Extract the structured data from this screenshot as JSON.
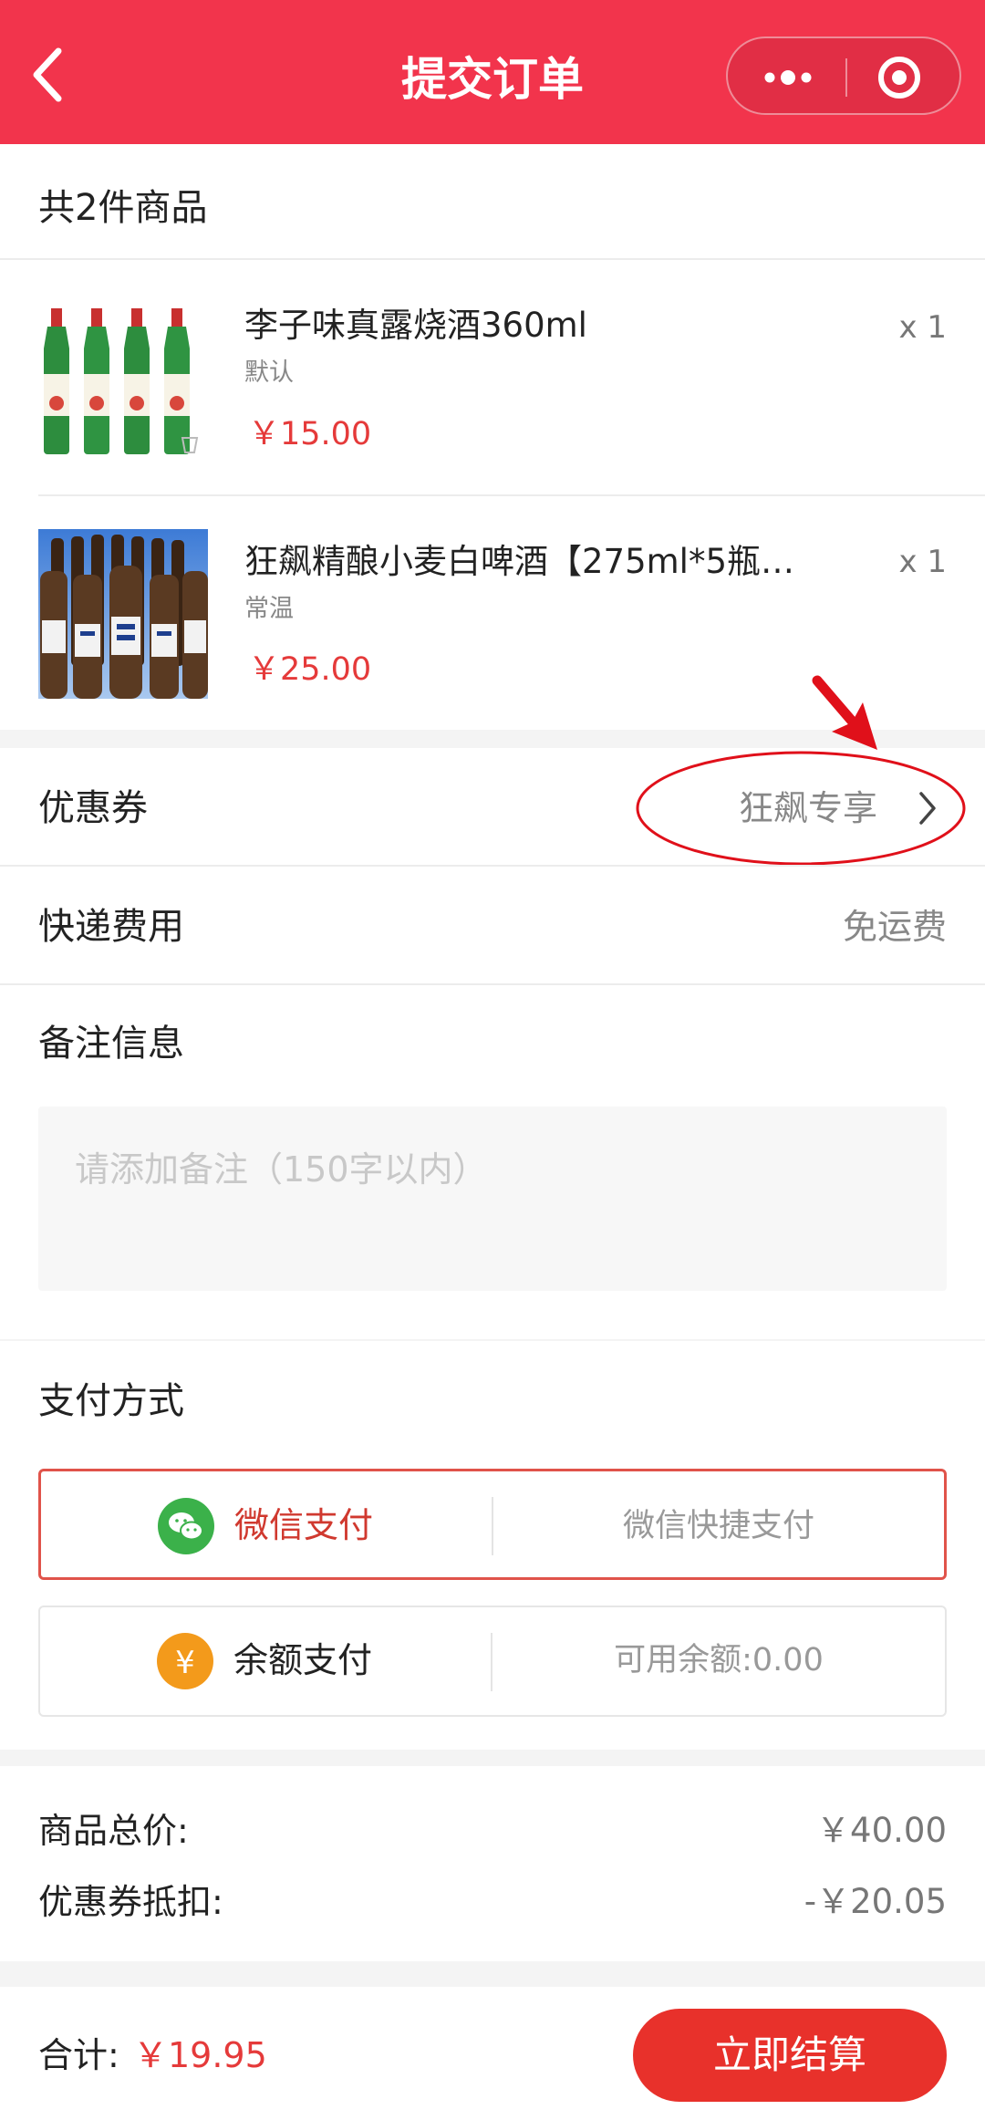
{
  "header": {
    "title": "提交订单"
  },
  "order": {
    "count_label": "共2件商品",
    "items": [
      {
        "name": "李子味真露烧酒360ml",
        "spec": "默认",
        "price": "￥15.00",
        "qty": "x 1"
      },
      {
        "name": "狂飙精酿小麦白啤酒【275ml*5瓶…",
        "spec": "常温",
        "price": "￥25.00",
        "qty": "x 1"
      }
    ]
  },
  "coupon": {
    "label": "优惠券",
    "value": "狂飙专享"
  },
  "shipping": {
    "label": "快递费用",
    "value": "免运费"
  },
  "remark": {
    "label": "备注信息",
    "placeholder": "请添加备注（150字以内）"
  },
  "payment": {
    "label": "支付方式",
    "methods": [
      {
        "name": "微信支付",
        "desc": "微信快捷支付",
        "selected": true,
        "icon": "wechat-icon",
        "color": "#3bb14a"
      },
      {
        "name": "余额支付",
        "desc": "可用余额:0.00",
        "selected": false,
        "icon": "yen-icon",
        "color": "#f39a1b"
      }
    ]
  },
  "summary": {
    "goods_total_label": "商品总价:",
    "goods_total_value": "￥40.00",
    "discount_label": "优惠券抵扣:",
    "discount_value": "-￥20.05"
  },
  "footer": {
    "total_label": "合计:",
    "total_value": "￥19.95",
    "checkout_label": "立即结算"
  },
  "colors": {
    "brand": "#f2344c",
    "price": "#e53a3a",
    "button": "#e8312b",
    "annotation": "#e0101a"
  }
}
